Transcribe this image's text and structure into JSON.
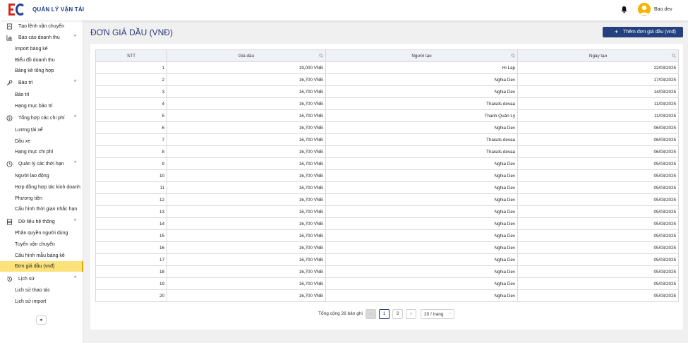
{
  "header": {
    "brand": "QUẢN LÝ VẬN TẢI",
    "user_name": "Bao dev",
    "accent_color": "#24407f",
    "avatar_color": "#f5b400"
  },
  "sidebar": {
    "top_item": "Tạo lệnh vận chuyển",
    "groups": [
      {
        "label": "Báo cáo doanh thu",
        "icon": "bar-chart-icon",
        "items": [
          "Import bảng kê",
          "Biểu đồ doanh thu",
          "Bảng kê tổng hợp"
        ]
      },
      {
        "label": "Bảo trì",
        "icon": "wrench-icon",
        "items": [
          "Bảo trì",
          "Hạng mục bảo trì"
        ]
      },
      {
        "label": "Tổng hợp các chi phí",
        "icon": "dollar-icon",
        "items": [
          "Lương tài xế",
          "Dầu xe",
          "Hạng mục chi phí"
        ]
      },
      {
        "label": "Quản lý các thời hạn",
        "icon": "clock-icon",
        "items": [
          "Người lao động",
          "Hợp đồng hợp tác kinh doanh",
          "Phương tiện",
          "Cấu hình thời gian nhắc hạn"
        ]
      },
      {
        "label": "Dữ liệu hệ thống",
        "icon": "database-icon",
        "items": [
          "Phân quyền người dùng",
          "Tuyến vận chuyển",
          "Cấu hình mẫu bảng kê",
          "Đơn giá dầu (vnđ)"
        ]
      },
      {
        "label": "Lịch sử",
        "icon": "history-icon",
        "items": [
          "Lịch sử thao tác",
          "Lịch sử import"
        ]
      }
    ],
    "active_item": "Đơn giá dầu (vnđ)"
  },
  "main": {
    "title": "ĐƠN GIÁ DẦU (VNĐ)",
    "add_button": "Thêm đơn giá dầu (vnđ)",
    "columns": [
      "STT",
      "Giá dầu",
      "Người tạo",
      "Ngày tạo"
    ],
    "rows": [
      [
        "1",
        "19,000 VNĐ",
        "Hi Lap",
        "22/03/2025"
      ],
      [
        "2",
        "16,700 VNĐ",
        "Nghia Dev",
        "17/03/2025"
      ],
      [
        "3",
        "16,700 VNĐ",
        "Nghia Dev",
        "14/03/2025"
      ],
      [
        "4",
        "16,700 VNĐ",
        "Thaisds devaa",
        "11/03/2025"
      ],
      [
        "5",
        "16,700 VNĐ",
        "Thanh Quản Lý",
        "11/03/2025"
      ],
      [
        "6",
        "16,700 VNĐ",
        "Nghia Dev",
        "06/03/2025"
      ],
      [
        "7",
        "16,700 VNĐ",
        "Thaisds devaa",
        "06/03/2025"
      ],
      [
        "8",
        "16,700 VNĐ",
        "Thaisds devaa",
        "06/03/2025"
      ],
      [
        "9",
        "16,700 VNĐ",
        "Nghia Dev",
        "05/03/2025"
      ],
      [
        "10",
        "16,700 VNĐ",
        "Nghia Dev",
        "05/03/2025"
      ],
      [
        "11",
        "16,700 VNĐ",
        "Nghia Dev",
        "05/03/2025"
      ],
      [
        "12",
        "16,700 VNĐ",
        "Nghia Dev",
        "05/03/2025"
      ],
      [
        "13",
        "16,700 VNĐ",
        "Nghia Dev",
        "05/03/2025"
      ],
      [
        "14",
        "16,700 VNĐ",
        "Nghia Dev",
        "05/03/2025"
      ],
      [
        "15",
        "16,700 VNĐ",
        "Nghia Dev",
        "05/03/2025"
      ],
      [
        "16",
        "16,700 VNĐ",
        "Nghia Dev",
        "05/03/2025"
      ],
      [
        "17",
        "16,700 VNĐ",
        "Nghia Dev",
        "05/03/2025"
      ],
      [
        "18",
        "16,700 VNĐ",
        "Nghia Dev",
        "05/03/2025"
      ],
      [
        "19",
        "16,700 VNĐ",
        "Nghia Dev",
        "05/03/2025"
      ],
      [
        "20",
        "16,700 VNĐ",
        "Nghia Dev",
        "05/03/2025"
      ]
    ]
  },
  "pagination": {
    "total": "Tổng cộng 26 bản ghi",
    "pages": [
      "1",
      "2"
    ],
    "current": "1",
    "prev": "‹",
    "next": "›",
    "page_size": "20 / trang"
  }
}
